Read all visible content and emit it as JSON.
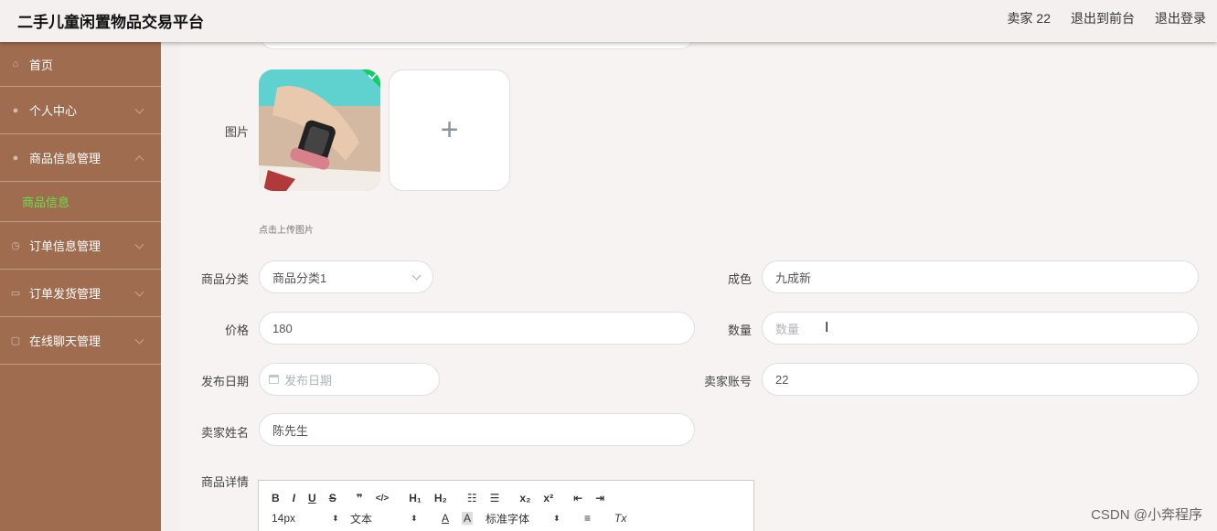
{
  "header": {
    "title": "二手儿童闲置物品交易平台",
    "seller": "卖家 22",
    "exit_front": "退出到前台",
    "logout": "退出登录"
  },
  "sidebar": {
    "home": "首页",
    "personal": "个人中心",
    "goods_mgmt": "商品信息管理",
    "goods_info": "商品信息",
    "order_mgmt": "订单信息管理",
    "ship_mgmt": "订单发货管理",
    "chat_mgmt": "在线聊天管理"
  },
  "form": {
    "image_label": "图片",
    "upload_hint": "点击上传图片",
    "upload_plus": "+",
    "category_label": "商品分类",
    "category_value": "商品分类1",
    "condition_label": "成色",
    "condition_value": "九成新",
    "price_label": "价格",
    "price_value": "180",
    "quantity_label": "数量",
    "quantity_placeholder": "数量",
    "date_label": "发布日期",
    "date_placeholder": "发布日期",
    "account_label": "卖家账号",
    "account_value": "22",
    "name_label": "卖家姓名",
    "name_value": "陈先生",
    "detail_label": "商品详情"
  },
  "editor": {
    "bold": "B",
    "italic": "I",
    "underline": "U",
    "strike": "S",
    "quote": "❞",
    "code": "</>",
    "h1": "H₁",
    "h2": "H₂",
    "ol": "☷",
    "ul": "☰",
    "sub": "x₂",
    "sup": "x²",
    "outdent": "⇤",
    "indent": "⇥",
    "size": "14px",
    "header": "文本",
    "color": "A",
    "bg": "A",
    "font": "标准字体",
    "align": "≡",
    "clean": "Tx"
  },
  "watermark": "CSDN @小奔程序"
}
